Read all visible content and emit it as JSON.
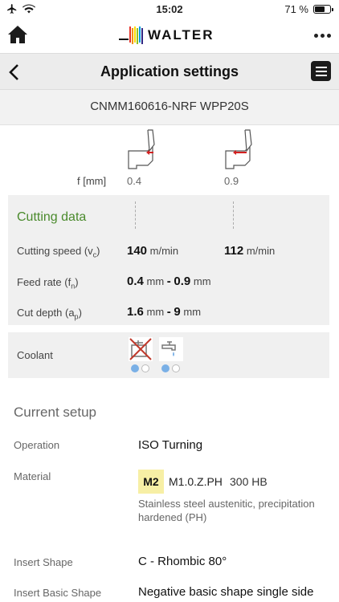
{
  "status_bar": {
    "time": "15:02",
    "battery_text": "71 %",
    "battery_level": 0.71
  },
  "brand": {
    "logo_text": "WALTER",
    "logo_colors": [
      "#e6332a",
      "#f39200",
      "#ffdd00",
      "#95c11f",
      "#009fe3",
      "#312783"
    ]
  },
  "header": {
    "title": "Application settings"
  },
  "product": {
    "name": "CNMM160616-NRF WPP20S"
  },
  "inserts": {
    "f_label": "f [mm]",
    "values": [
      "0.4",
      "0.9"
    ]
  },
  "cutting_data": {
    "title": "Cutting data",
    "title_color": "#4a8a2c",
    "cutting_speed": {
      "label": "Cutting speed (v",
      "sub": "c",
      "suffix": ")",
      "col1_value": "140",
      "col1_unit": "m/min",
      "col2_value": "112",
      "col2_unit": "m/min"
    },
    "feed_rate": {
      "label": "Feed rate (f",
      "sub": "n",
      "suffix": ")",
      "from": "0.4",
      "from_unit": "mm",
      "sep": "-",
      "to": "0.9",
      "to_unit": "mm"
    },
    "cut_depth": {
      "label": "Cut depth (a",
      "sub": "p",
      "suffix": ")",
      "from": "1.6",
      "from_unit": "mm",
      "sep": "-",
      "to": "9",
      "to_unit": "mm"
    }
  },
  "coolant": {
    "label": "Coolant",
    "icons": [
      "no-coolant-icon",
      "coolant-tap-icon"
    ]
  },
  "current_setup": {
    "title": "Current setup",
    "operation": {
      "label": "Operation",
      "value": "ISO Turning"
    },
    "material": {
      "label": "Material",
      "group": "M2",
      "code": "M1.0.Z.PH",
      "hardness": "300 HB",
      "description": "Stainless steel austenitic, precipitation hardened (PH)",
      "badge_color": "#f7efa5"
    },
    "insert_shape": {
      "label": "Insert Shape",
      "value": "C - Rhombic 80°"
    },
    "insert_basic_shape": {
      "label": "Insert Basic Shape",
      "value": "Negative basic shape single side"
    }
  }
}
